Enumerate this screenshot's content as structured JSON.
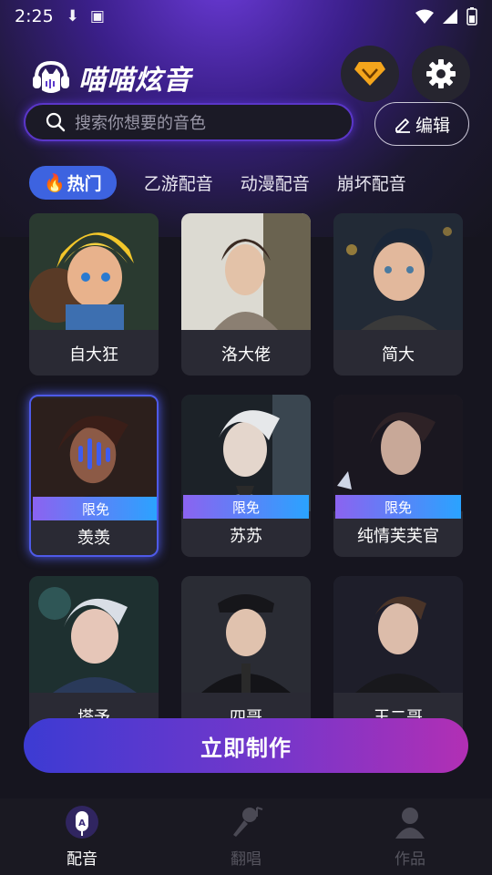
{
  "status_bar": {
    "time": "2:25"
  },
  "app": {
    "title": "喵喵炫音"
  },
  "search": {
    "placeholder": "搜索你想要的音色"
  },
  "edit_button": {
    "label": "编辑"
  },
  "tabs": [
    {
      "label": "热门",
      "active": true
    },
    {
      "label": "乙游配音",
      "active": false
    },
    {
      "label": "动漫配音",
      "active": false
    },
    {
      "label": "崩坏配音",
      "active": false
    }
  ],
  "free_badge_label": "限免",
  "cards": [
    {
      "name": "自大狂",
      "free": false,
      "selected": false
    },
    {
      "name": "洛大佬",
      "free": false,
      "selected": false
    },
    {
      "name": "简大",
      "free": false,
      "selected": false
    },
    {
      "name": "羡羡",
      "free": true,
      "selected": true
    },
    {
      "name": "苏苏",
      "free": true,
      "selected": false
    },
    {
      "name": "纯情芙芙官",
      "free": true,
      "selected": false
    },
    {
      "name": "塔予",
      "free": false,
      "selected": false
    },
    {
      "name": "四哥",
      "free": false,
      "selected": false
    },
    {
      "name": "王二哥",
      "free": false,
      "selected": false
    }
  ],
  "cta": {
    "label": "立即制作"
  },
  "bottom_nav": [
    {
      "label": "配音",
      "icon": "microphone-icon",
      "active": true
    },
    {
      "label": "翻唱",
      "icon": "karaoke-mic-icon",
      "active": false
    },
    {
      "label": "作品",
      "icon": "profile-icon",
      "active": false
    }
  ],
  "colors": {
    "accent": "#3d63e0",
    "cta_start": "#3c3bd3",
    "cta_end": "#b22fb4",
    "vip": "#f4a51c"
  }
}
